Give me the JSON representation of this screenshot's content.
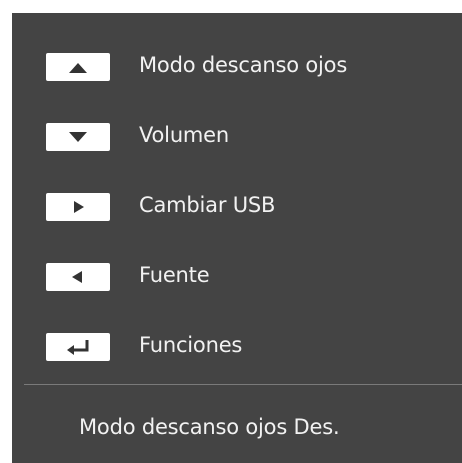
{
  "osd": {
    "menu": [
      {
        "key_icon": "up-arrow-icon",
        "label": "Modo descanso ojos"
      },
      {
        "key_icon": "down-arrow-icon",
        "label": "Volumen"
      },
      {
        "key_icon": "right-arrow-icon",
        "label": "Cambiar USB"
      },
      {
        "key_icon": "left-arrow-icon",
        "label": "Fuente"
      },
      {
        "key_icon": "enter-icon",
        "label": "Funciones"
      }
    ],
    "status": "Modo descanso ojos Des.",
    "colors": {
      "panel_background": "#444444",
      "key_background": "#ffffff",
      "key_glyph": "#333333",
      "text": "#f2f2f2",
      "divider": "#7a7a7a"
    }
  }
}
